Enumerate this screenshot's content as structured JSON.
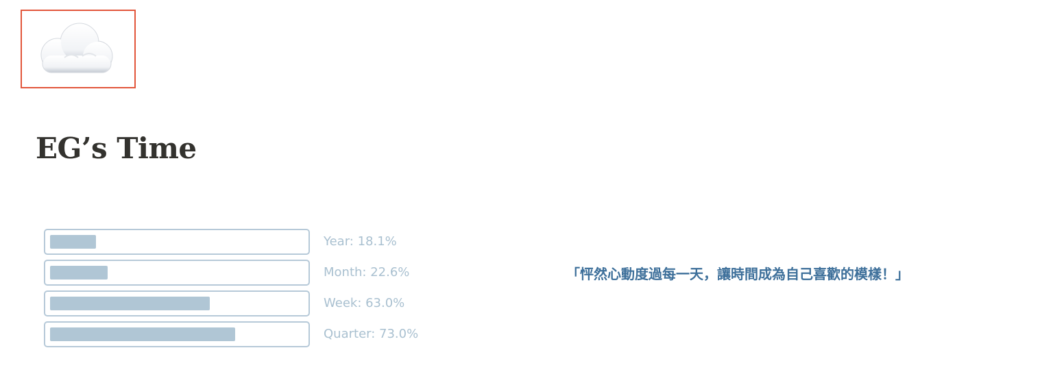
{
  "header": {
    "icon": "cloud-icon",
    "title": "EG’s Time"
  },
  "progress": [
    {
      "label": "Year: 18.1%",
      "fraction": 0.181,
      "display_fraction": 0.181
    },
    {
      "label": "Month: 22.6%",
      "fraction": 0.226,
      "display_fraction": 0.226
    },
    {
      "label": "Week: 63.0%",
      "fraction": 0.63,
      "display_fraction": 0.63
    },
    {
      "label": "Quarter: 73.0%",
      "fraction": 0.73,
      "display_fraction": 0.73
    }
  ],
  "quote": "「怦然心動度過每一天，讓時間成為自己喜歡的模樣！」",
  "colors": {
    "highlight_border": "#e2553a",
    "title": "#33322e",
    "track_border": "#b6c9d8",
    "fill": "#b0c6d5",
    "label": "#a9c0d0",
    "quote": "#3d6f9a"
  }
}
